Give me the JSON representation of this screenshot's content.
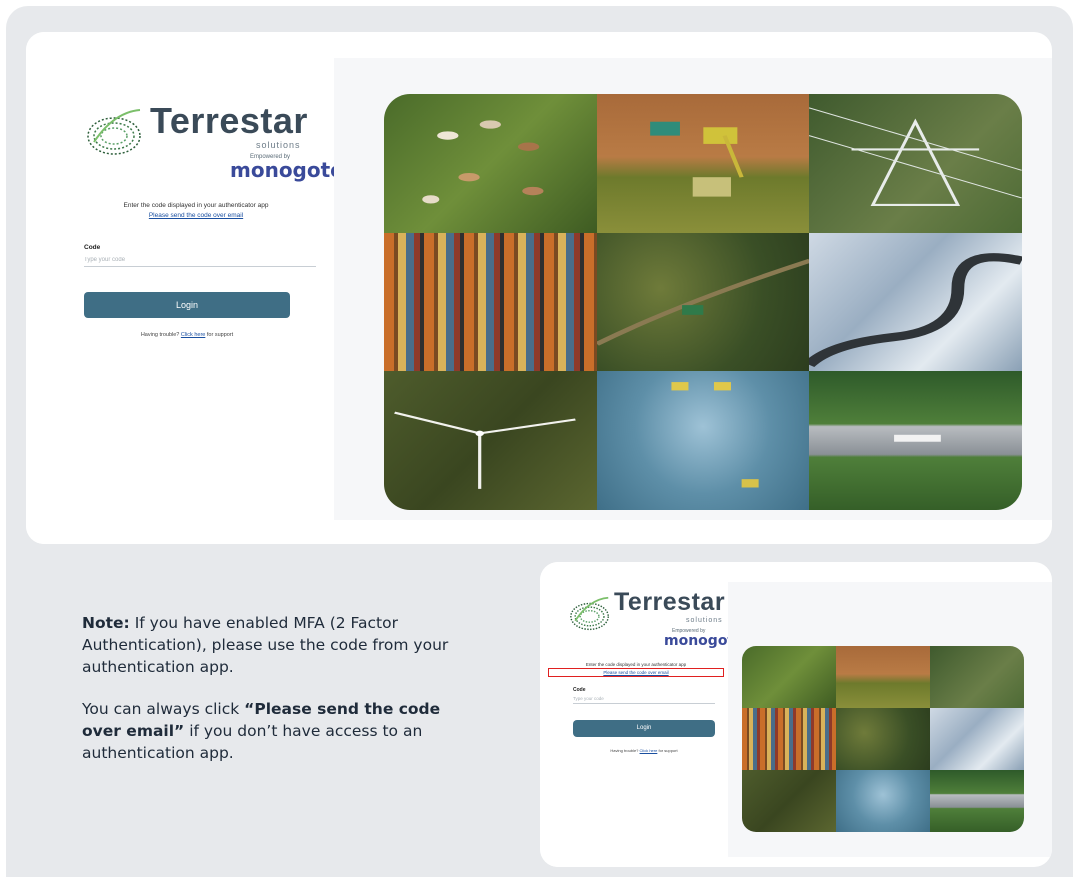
{
  "login": {
    "brand": "Terrestar",
    "brand_sub": "solutions",
    "powered_by": "Empowered by",
    "partner": "monogoto",
    "instruction": "Enter the code displayed in your authenticator app",
    "email_link": "Please send the code over email",
    "code_label": "Code",
    "code_placeholder": "Type your code",
    "login_button": "Login",
    "help_prefix": "Having trouble?",
    "help_link": "Click here",
    "help_suffix": "for support"
  },
  "note": {
    "lead": "Note:",
    "text1": "If you have enabled MFA (2 Factor Authentication), please use the code from your authentication app.",
    "text2_prefix": "You can always click",
    "text2_bold": "“Please send the code over email”",
    "text2_suffix": "if you don’t have access to an authentication app."
  },
  "colors": {
    "background": "#e7e9ec",
    "login_button": "#3f6e85",
    "highlight_box": "#e02020"
  },
  "mosaic_tiles": [
    "cows-in-pasture",
    "harvester-in-field",
    "power-pylon",
    "shipping-containers",
    "forest-tractor",
    "winding-road-snow",
    "wind-turbine",
    "quarry-trucks",
    "truck-on-highway"
  ]
}
